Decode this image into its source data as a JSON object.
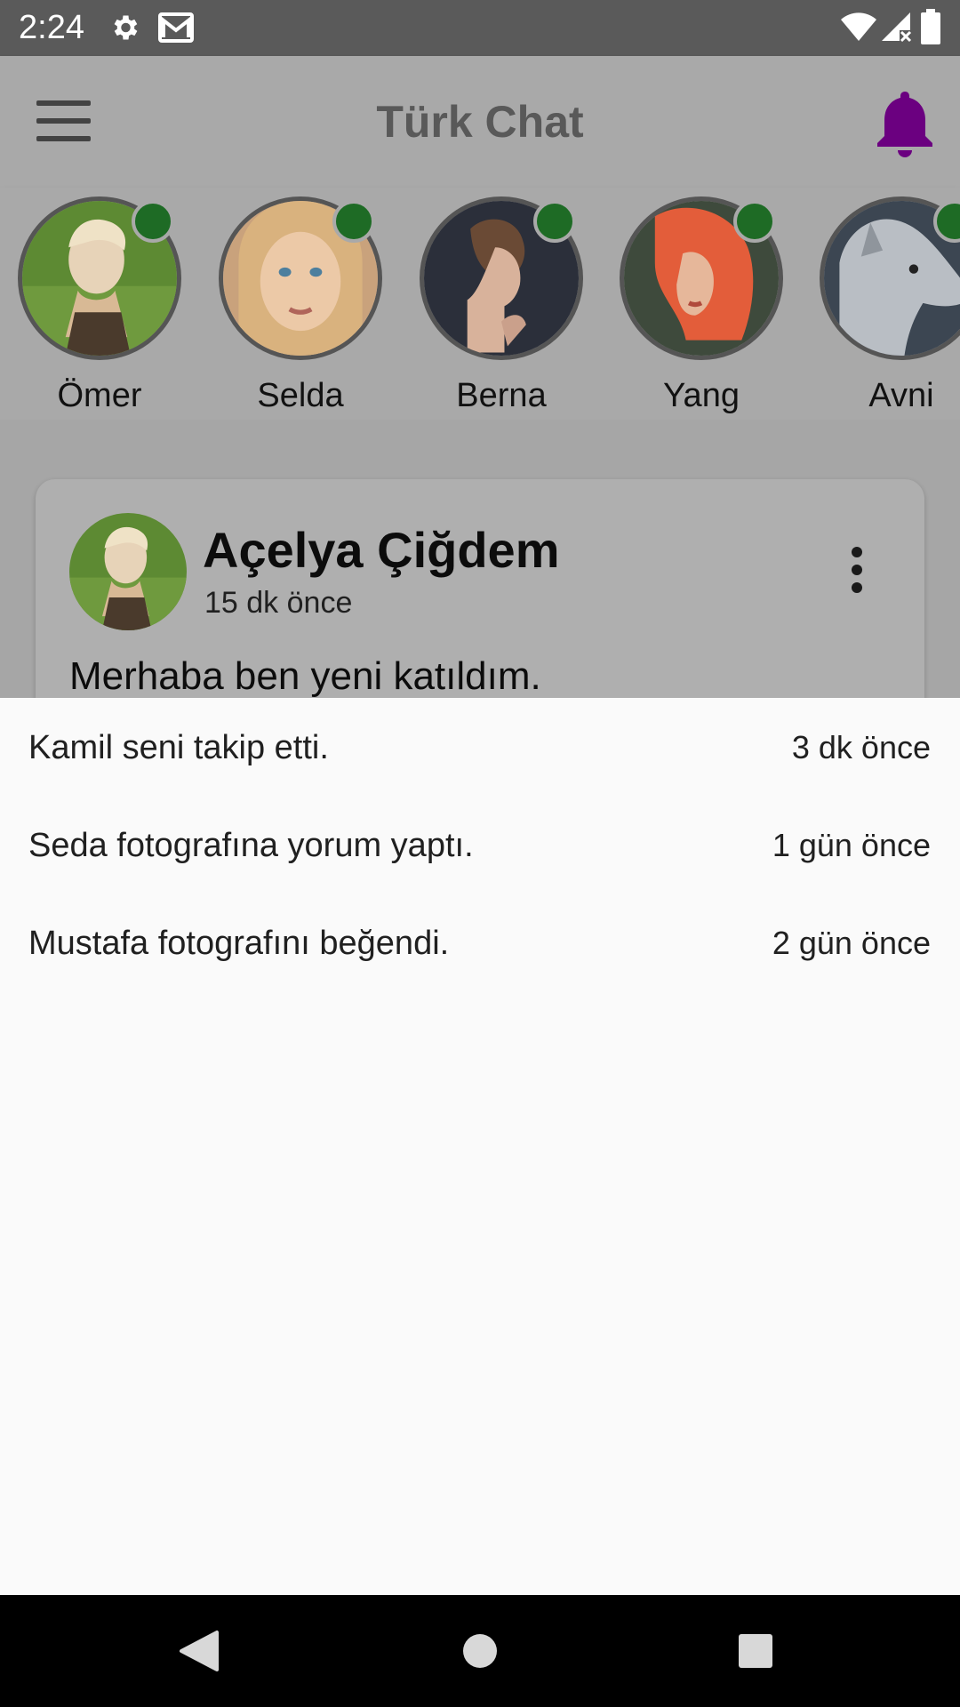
{
  "status_bar": {
    "time": "2:24",
    "icons": [
      "gear-icon",
      "gmail-icon",
      "wifi-icon",
      "signal-icon",
      "battery-icon"
    ]
  },
  "app_bar": {
    "title": "Türk Chat",
    "menu_icon": "hamburger-menu-icon",
    "notification_icon": "bell-icon",
    "accent_color": "#6b0080"
  },
  "stories": [
    {
      "name": "Ömer",
      "online": true
    },
    {
      "name": "Selda",
      "online": true
    },
    {
      "name": "Berna",
      "online": true
    },
    {
      "name": "Yang",
      "online": true
    },
    {
      "name": "Avni",
      "online": true
    }
  ],
  "post": {
    "author": "Açelya Çiğdem",
    "time": "15 dk önce",
    "text": "Merhaba ben yeni katıldım.",
    "more_icon": "more-vertical-icon"
  },
  "notifications": [
    {
      "text": "Kamil seni takip etti.",
      "time": "3 dk önce"
    },
    {
      "text": "Seda fotografına yorum yaptı.",
      "time": "1 gün önce"
    },
    {
      "text": "Mustafa fotografını beğendi.",
      "time": "2 gün önce"
    }
  ],
  "nav_bar": {
    "icons": [
      "back-triangle-icon",
      "home-circle-icon",
      "recents-square-icon"
    ]
  },
  "colors": {
    "online": "#1e6b25",
    "scrim": "#a9a9a9",
    "sheet": "#fafafa"
  }
}
